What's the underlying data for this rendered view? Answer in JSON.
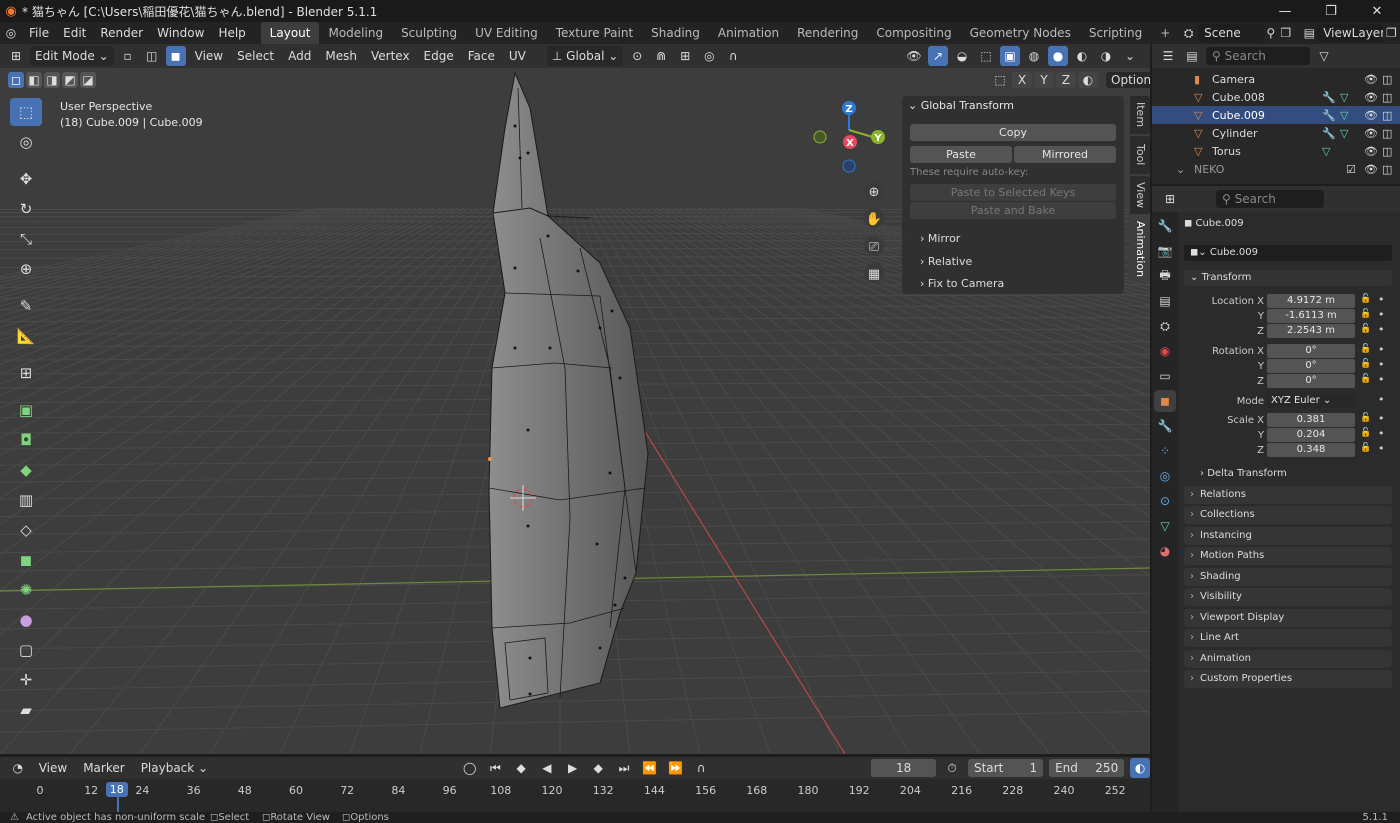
{
  "title": "* 猫ちゃん [C:\\Users\\稲田優花\\猫ちゃん.blend] - Blender 5.1.1",
  "menus": [
    "File",
    "Edit",
    "Render",
    "Window",
    "Help"
  ],
  "workspaces": [
    "Layout",
    "Modeling",
    "Sculpting",
    "UV Editing",
    "Texture Paint",
    "Shading",
    "Animation",
    "Rendering",
    "Compositing",
    "Geometry Nodes",
    "Scripting"
  ],
  "active_workspace": "Layout",
  "add_workspace": "+",
  "scene": "Scene",
  "view_layer": "ViewLayer",
  "viewport_header": {
    "mode": "Edit Mode",
    "menus": [
      "View",
      "Select",
      "Add",
      "Mesh",
      "Vertex",
      "Edge",
      "Face",
      "UV"
    ],
    "orientation": "Global",
    "options": "Options"
  },
  "viewport": {
    "view_name": "User Perspective",
    "object_info": "(18) Cube.009 | Cube.009",
    "gizmo": {
      "z": "Z",
      "y": "Y",
      "x": "X"
    }
  },
  "npanel": {
    "title": "Global Transform",
    "copy": "Copy",
    "paste": "Paste",
    "mirrored": "Mirrored",
    "note": "These require auto-key:",
    "paste_selected": "Paste to Selected Keys",
    "paste_bake": "Paste and Bake",
    "subsections": [
      "Mirror",
      "Relative",
      "Fix to Camera"
    ],
    "tabs": [
      "Item",
      "Tool",
      "View",
      "Animation"
    ],
    "active_tab": "Animation"
  },
  "outliner": {
    "search_placeholder": "Search",
    "items": [
      {
        "name": "Camera"
      },
      {
        "name": "Cube.008"
      },
      {
        "name": "Cube.009"
      },
      {
        "name": "Cylinder"
      },
      {
        "name": "Torus"
      },
      {
        "name": "NEKO"
      }
    ],
    "selected": "Cube.009"
  },
  "properties": {
    "search_placeholder": "Search",
    "object_name": "Cube.009",
    "datablock": "Cube.009",
    "transform_title": "Transform",
    "location_label": "Location X",
    "rotation_label": "Rotation X",
    "scale_label": "Scale X",
    "axis_y": "Y",
    "axis_z": "Z",
    "location": [
      "4.9172 m",
      "-1.6113 m",
      "2.2543 m"
    ],
    "rotation": [
      "0°",
      "0°",
      "0°"
    ],
    "mode_label": "Mode",
    "mode": "XYZ Euler",
    "scale": [
      "0.381",
      "0.204",
      "0.348"
    ],
    "delta": "Delta Transform",
    "sections": [
      "Relations",
      "Collections",
      "Instancing",
      "Motion Paths",
      "Shading",
      "Visibility",
      "Viewport Display",
      "Line Art",
      "Animation",
      "Custom Properties"
    ]
  },
  "timeline": {
    "menus": [
      "View",
      "Marker",
      "Playback"
    ],
    "current_frame": "18",
    "start_label": "Start",
    "start": "1",
    "end_label": "End",
    "end": "250",
    "ticks": [
      "0",
      "12",
      "18",
      "24",
      "36",
      "48",
      "60",
      "72",
      "84",
      "96",
      "108",
      "120",
      "132",
      "144",
      "156",
      "168",
      "180",
      "192",
      "204",
      "216",
      "228",
      "240",
      "252"
    ]
  },
  "status": {
    "message": "Active object has non-uniform scale",
    "select": "Select",
    "rotate": "Rotate View",
    "options": "Options",
    "version": "5.1.1"
  },
  "colors": {
    "accent": "#4772b3",
    "selected_row": "#334d80",
    "x_axis": "#e8485e",
    "y_axis": "#8ab32c",
    "z_axis": "#2e79d6"
  }
}
